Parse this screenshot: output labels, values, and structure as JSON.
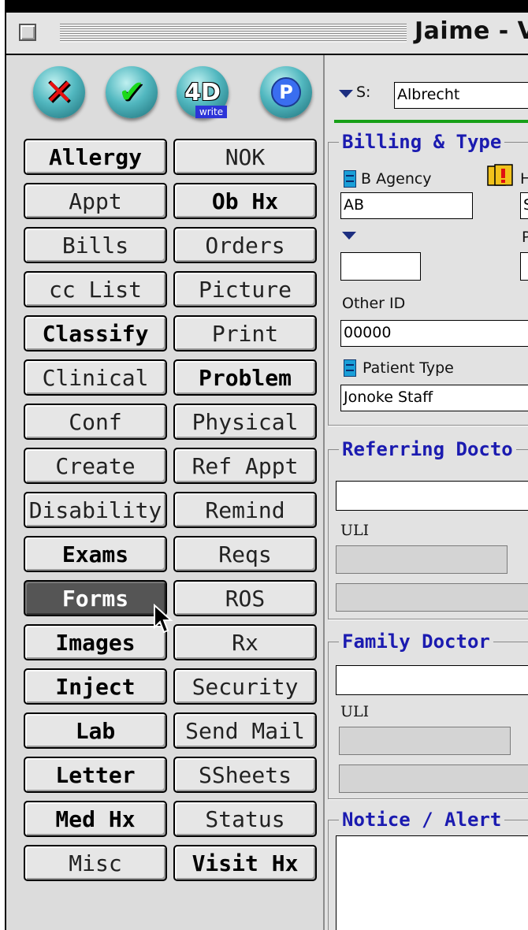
{
  "window": {
    "title": "Jaime - V"
  },
  "toolbar": {
    "cancel_icon": "red-x-icon",
    "confirm_icon": "green-check-icon",
    "write_badge": "write",
    "fourd_label": "4D",
    "p_label": "P"
  },
  "buttons_left": [
    {
      "label": "Allergy",
      "bold": true
    },
    {
      "label": "Appt",
      "bold": false
    },
    {
      "label": "Bills",
      "bold": false
    },
    {
      "label": "cc List",
      "bold": false
    },
    {
      "label": "Classify",
      "bold": true
    },
    {
      "label": "Clinical",
      "bold": false
    },
    {
      "label": "Conf",
      "bold": false
    },
    {
      "label": "Create",
      "bold": false
    },
    {
      "label": "Disability",
      "bold": false
    },
    {
      "label": "Exams",
      "bold": true
    },
    {
      "label": "Forms",
      "bold": true,
      "active": true
    },
    {
      "label": "Images",
      "bold": true
    },
    {
      "label": "Inject",
      "bold": true
    },
    {
      "label": "Lab",
      "bold": true
    },
    {
      "label": "Letter",
      "bold": true
    },
    {
      "label": "Med Hx",
      "bold": true
    },
    {
      "label": "Misc",
      "bold": false
    }
  ],
  "buttons_right": [
    {
      "label": "NOK",
      "bold": false
    },
    {
      "label": "Ob Hx",
      "bold": true
    },
    {
      "label": "Orders",
      "bold": false
    },
    {
      "label": "Picture",
      "bold": false
    },
    {
      "label": "Print",
      "bold": false
    },
    {
      "label": "Problem",
      "bold": true
    },
    {
      "label": "Physical",
      "bold": false
    },
    {
      "label": "Ref Appt",
      "bold": false
    },
    {
      "label": "Remind",
      "bold": false
    },
    {
      "label": "Reqs",
      "bold": false
    },
    {
      "label": "ROS",
      "bold": false
    },
    {
      "label": "Rx",
      "bold": false
    },
    {
      "label": "Security",
      "bold": false
    },
    {
      "label": "Send Mail",
      "bold": false
    },
    {
      "label": "SSheets",
      "bold": false
    },
    {
      "label": "Status",
      "bold": false
    },
    {
      "label": "Visit Hx",
      "bold": true
    }
  ],
  "form": {
    "s_label": "S:",
    "s_value": "Albrecht",
    "billing_title": "Billing & Type",
    "b_agency_label": "B Agency",
    "b_agency_value": "AB",
    "h_partial": "H",
    "h_value_partial": "S",
    "p_partial": "P",
    "other_id_label": "Other ID",
    "other_id_value": "00000",
    "patient_type_label": "Patient Type",
    "patient_type_value": "Jonoke Staff",
    "referring_title": "Referring Docto",
    "referring_uli_label": "ULI",
    "family_title": "Family Doctor",
    "family_uli_label": "ULI",
    "notice_title": "Notice / Alert"
  }
}
